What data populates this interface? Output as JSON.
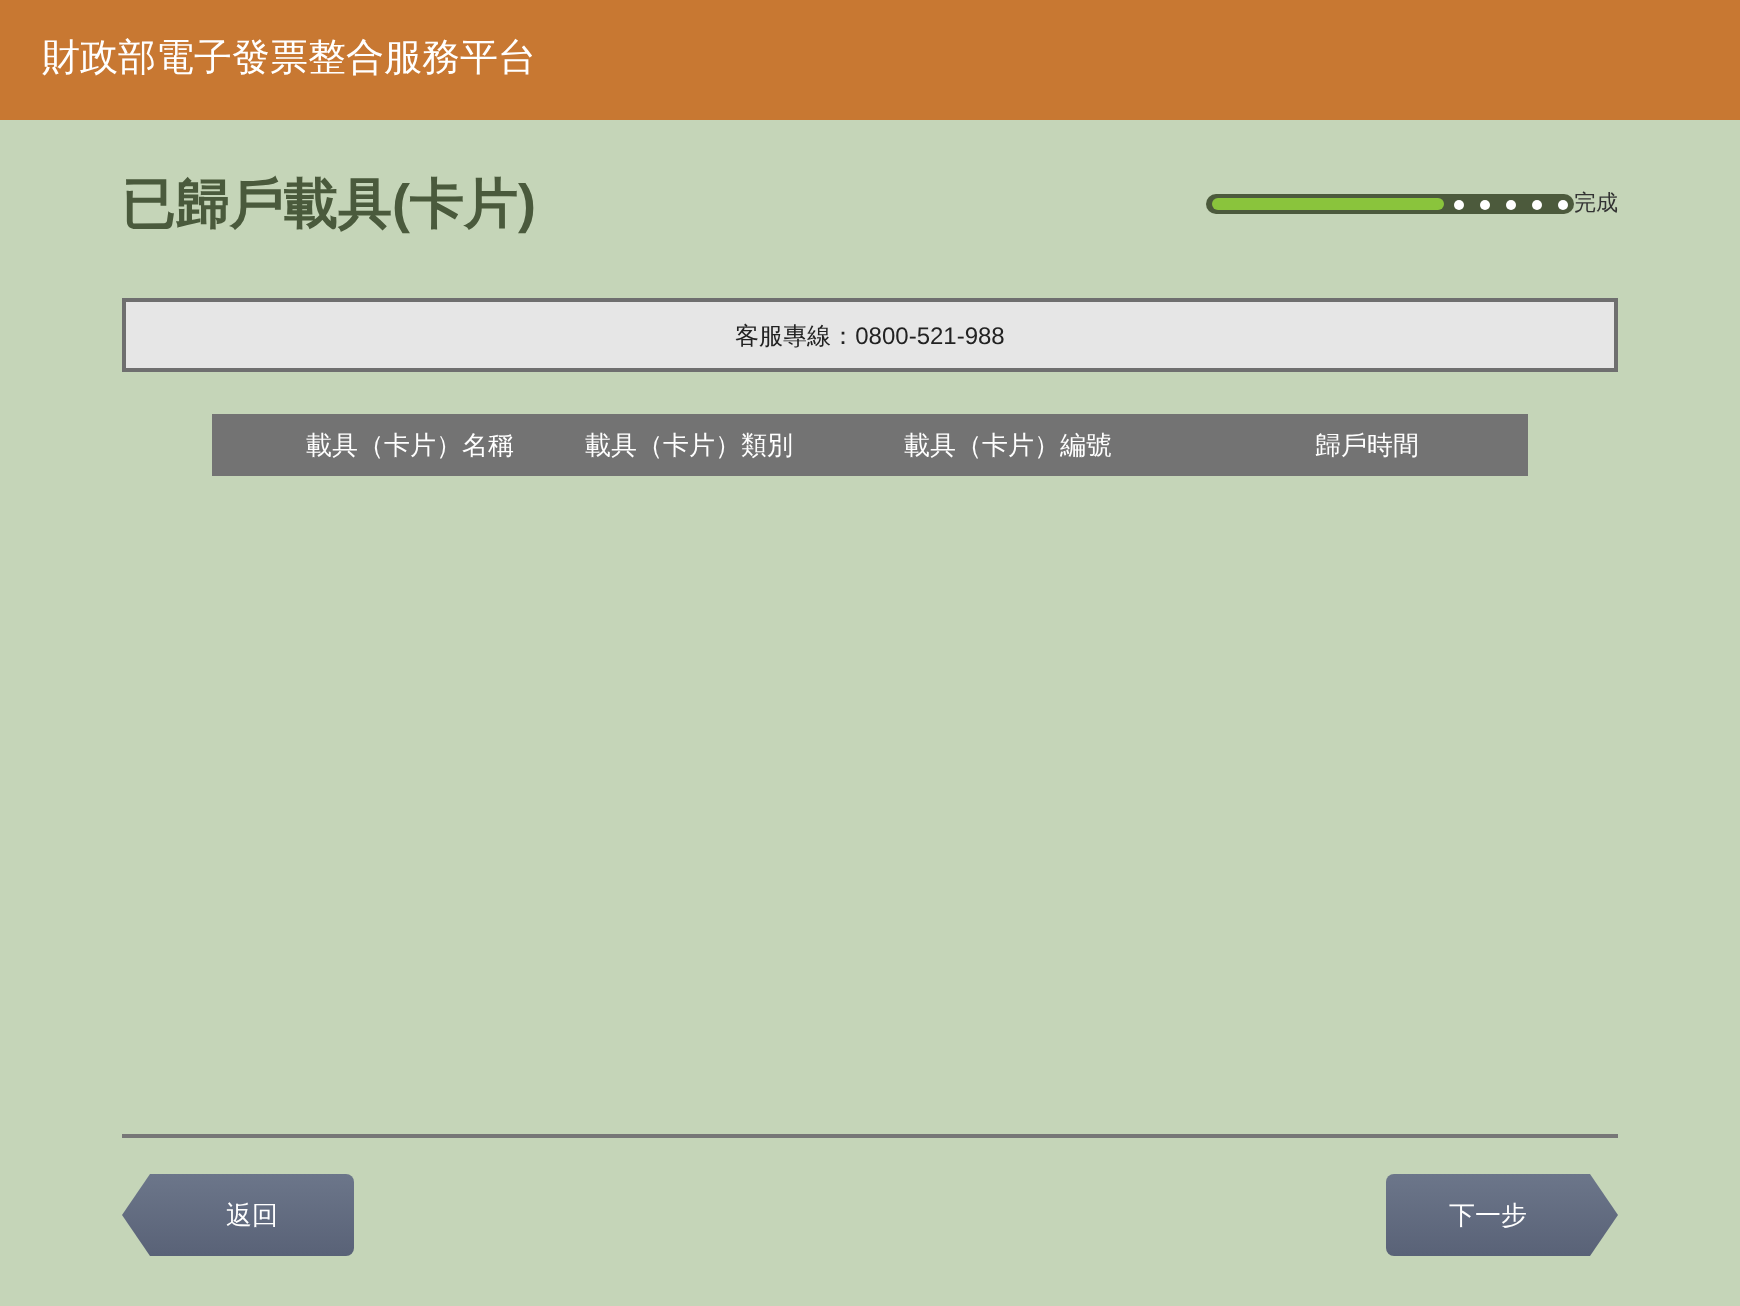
{
  "header": {
    "title": "財政部電子發票整合服務平台"
  },
  "page": {
    "title": "已歸戶載具(卡片)"
  },
  "progress": {
    "level": 0.65,
    "label": "完成"
  },
  "notice": {
    "text": "客服專線：0800-521-988"
  },
  "table": {
    "columns": [
      "載具（卡片）名稱",
      "載具（卡片）類別",
      "載具（卡片）編號",
      "歸戶時間"
    ]
  },
  "buttons": [
    {
      "label": "返回",
      "kind": "back"
    },
    {
      "label": "下一步",
      "kind": "next"
    }
  ]
}
